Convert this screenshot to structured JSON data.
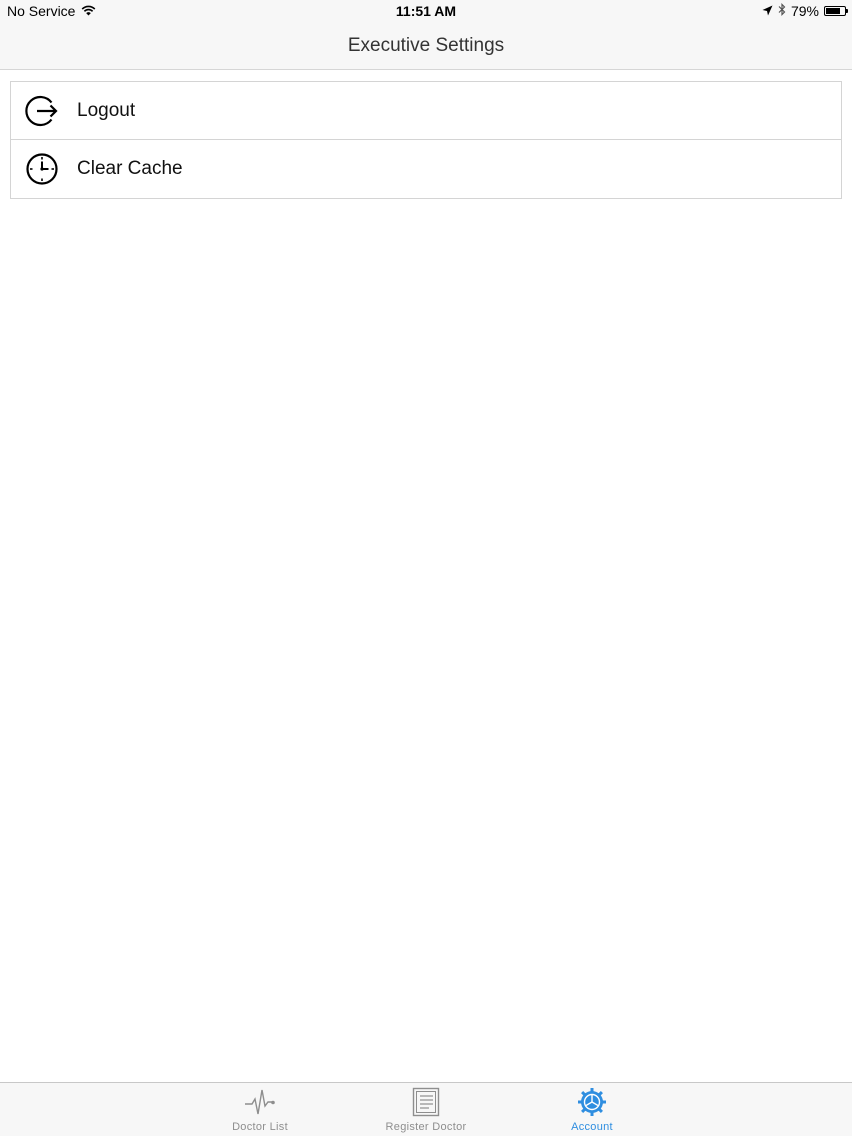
{
  "status_bar": {
    "carrier": "No Service",
    "time": "11:51 AM",
    "battery": "79%",
    "battery_level": 0.79
  },
  "nav": {
    "title": "Executive Settings"
  },
  "menu": {
    "items": [
      {
        "label": "Logout",
        "icon": "logout-icon"
      },
      {
        "label": "Clear Cache",
        "icon": "clock-icon"
      }
    ]
  },
  "tabs": [
    {
      "label": "Doctor List",
      "icon": "heartbeat-icon",
      "active": false
    },
    {
      "label": "Register Doctor",
      "icon": "document-icon",
      "active": false
    },
    {
      "label": "Account",
      "icon": "gear-icon",
      "active": true
    }
  ],
  "colors": {
    "accent": "#2f8ee0",
    "inactive_tab": "#8e8e8e",
    "bar_background": "#f7f7f7"
  }
}
